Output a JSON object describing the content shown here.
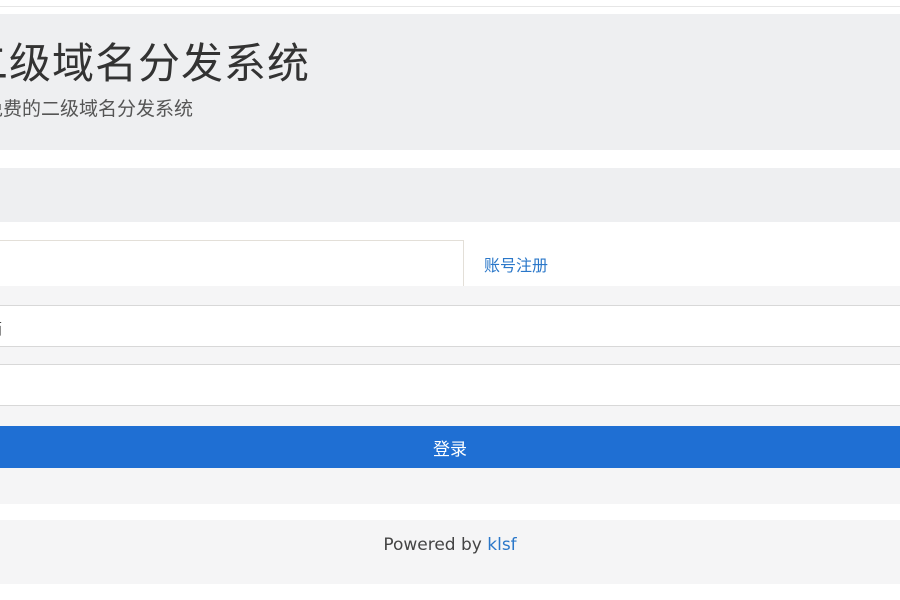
{
  "header": {
    "title": "二级域名分发系统",
    "subtitle": "免费的二级域名分发系统"
  },
  "login": {
    "register_tab": "账号注册",
    "username_value": "箱",
    "password_value": "",
    "login_button": "登录"
  },
  "footer": {
    "powered_by": "Powered by",
    "link_text": "klsf"
  },
  "colors": {
    "accent": "#1f6fd3",
    "link": "#2a77c9",
    "background_gray": "#eeeff1"
  }
}
